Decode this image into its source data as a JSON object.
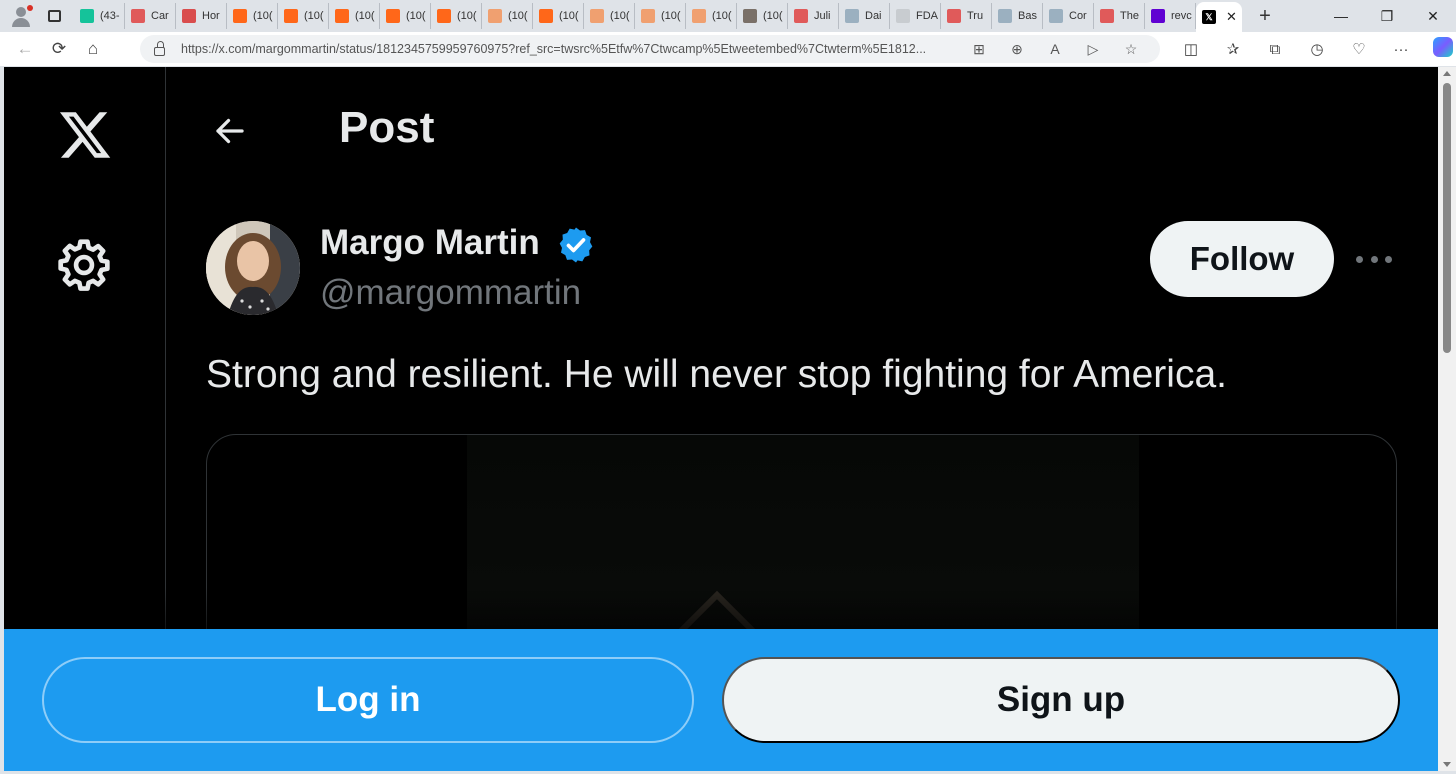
{
  "browser": {
    "tabs": [
      {
        "label": "(43-",
        "icon": "grammarly-icon",
        "color": "#15c39a"
      },
      {
        "label": "Car",
        "icon": "youtube-icon",
        "color": "#e05a5a"
      },
      {
        "label": "Hor",
        "icon": "podcast-icon",
        "color": "#d94d4d"
      },
      {
        "label": "(10(",
        "icon": "substack-icon",
        "color": "#ff6719"
      },
      {
        "label": "(10(",
        "icon": "substack-icon",
        "color": "#ff6719"
      },
      {
        "label": "(10(",
        "icon": "substack-icon",
        "color": "#ff6719"
      },
      {
        "label": "(10(",
        "icon": "substack-icon",
        "color": "#ff6719"
      },
      {
        "label": "(10(",
        "icon": "substack-icon",
        "color": "#ff6719"
      },
      {
        "label": "(10(",
        "icon": "substack-icon",
        "color": "#f0a070"
      },
      {
        "label": "(10(",
        "icon": "substack-icon",
        "color": "#ff6719"
      },
      {
        "label": "(10(",
        "icon": "substack-icon",
        "color": "#f0a070"
      },
      {
        "label": "(10(",
        "icon": "substack-icon",
        "color": "#f0a070"
      },
      {
        "label": "(10(",
        "icon": "substack-icon",
        "color": "#f0a070"
      },
      {
        "label": "(10(",
        "icon": "photo-icon",
        "color": "#7a7068"
      },
      {
        "label": "Juli",
        "icon": "youtube-icon",
        "color": "#e05a5a"
      },
      {
        "label": "Dai",
        "icon": "wave-icon",
        "color": "#9bb0c0"
      },
      {
        "label": "FDA",
        "icon": "page-icon",
        "color": "#c8ccd0"
      },
      {
        "label": "Tru",
        "icon": "youtube-icon",
        "color": "#e05a5a"
      },
      {
        "label": "Bas",
        "icon": "wave-icon",
        "color": "#9bb0c0"
      },
      {
        "label": "Cor",
        "icon": "wave-icon",
        "color": "#9bb0c0"
      },
      {
        "label": "The",
        "icon": "youtube-icon",
        "color": "#e05a5a"
      },
      {
        "label": "revc",
        "icon": "yahoo-icon",
        "color": "#6001d2"
      }
    ],
    "active_tab": {
      "icon": "x-icon",
      "color": "#000000"
    },
    "url": "https://x.com/margommartin/status/1812345759959760975?ref_src=twsrc%5Etfw%7Ctwcamp%5Etweetembed%7Ctwterm%5E1812..."
  },
  "page": {
    "header_title": "Post",
    "author": {
      "name": "Margo Martin",
      "handle": "@margommartin",
      "verified": true
    },
    "follow_label": "Follow",
    "tweet_text": "Strong and resilient. He will never stop fighting for America.",
    "login_label": "Log in",
    "signup_label": "Sign up"
  },
  "colors": {
    "brand_blue": "#1d9bf0",
    "verified_blue": "#1d9bf0",
    "background": "#000000",
    "text_primary": "#e7e9ea",
    "text_secondary": "#71767b"
  }
}
